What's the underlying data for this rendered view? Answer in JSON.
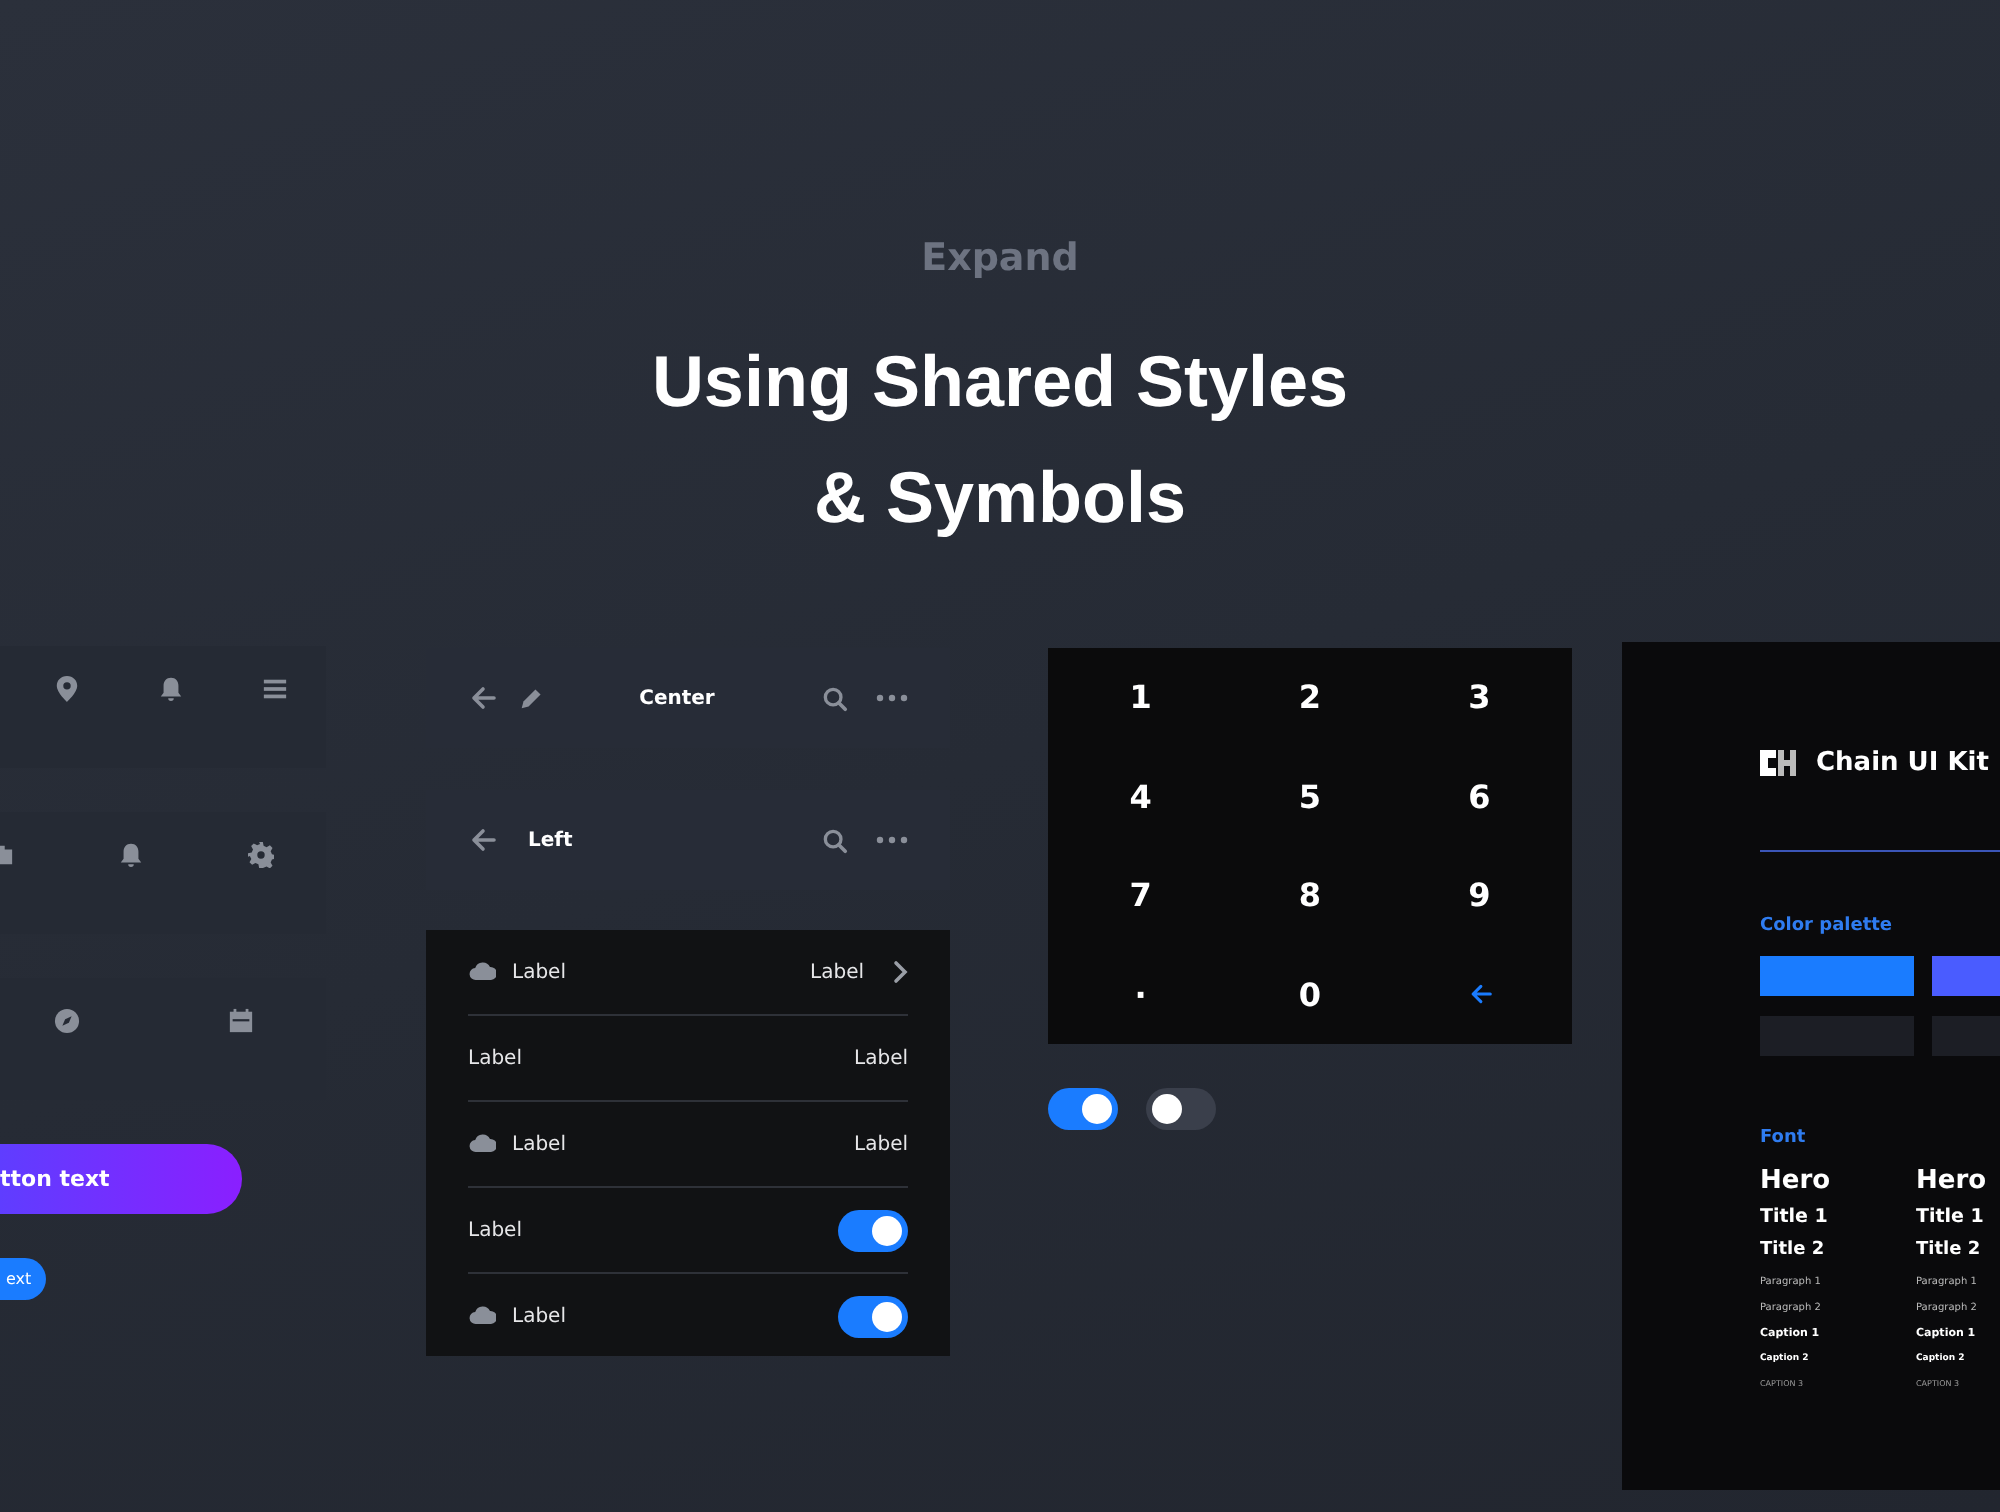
{
  "header": {
    "eyebrow": "Expand",
    "title_lines": [
      "Using Shared Styles",
      "& Symbols"
    ]
  },
  "gradient_button": {
    "label": "tton text"
  },
  "small_button": {
    "label": "ext"
  },
  "nav_bars": [
    {
      "kind": "center",
      "title": "Center"
    },
    {
      "kind": "left",
      "title": "Left"
    }
  ],
  "list_rows": [
    {
      "kind": "detail",
      "label": "Label",
      "cloud": true,
      "value": "Label",
      "chevron": true
    },
    {
      "kind": "detail",
      "label": "Label",
      "cloud": false,
      "value": "Label",
      "chevron": false
    },
    {
      "kind": "detail",
      "label": "Label",
      "cloud": true,
      "value": "Label",
      "chevron": false
    },
    {
      "kind": "toggle",
      "label": "Label",
      "cloud": false,
      "on": true
    },
    {
      "kind": "toggle",
      "label": "Label",
      "cloud": true,
      "on": true
    }
  ],
  "keypad": {
    "keys": [
      {
        "kind": "digit",
        "label": "1"
      },
      {
        "kind": "digit",
        "label": "2"
      },
      {
        "kind": "digit",
        "label": "3"
      },
      {
        "kind": "digit",
        "label": "4"
      },
      {
        "kind": "digit",
        "label": "5"
      },
      {
        "kind": "digit",
        "label": "6"
      },
      {
        "kind": "digit",
        "label": "7"
      },
      {
        "kind": "digit",
        "label": "8"
      },
      {
        "kind": "digit",
        "label": "9"
      },
      {
        "kind": "dot",
        "label": "·"
      },
      {
        "kind": "digit",
        "label": "0"
      },
      {
        "kind": "backspace"
      }
    ]
  },
  "toggles": [
    {
      "on": true
    },
    {
      "on": false
    }
  ],
  "style_guide": {
    "brand": "Chain UI Kit",
    "palette_heading": "Color palette",
    "swatches": [
      {
        "color": "#1a7cff"
      },
      {
        "color": "#4a5cff"
      },
      {
        "color": "#1c1e25"
      },
      {
        "color": "#1c1e25"
      }
    ],
    "font_heading": "Font",
    "type_columns": [
      {
        "styles": [
          {
            "kind": "hero",
            "text": "Hero"
          },
          {
            "kind": "title1",
            "text": "Title 1"
          },
          {
            "kind": "title2",
            "text": "Title 2"
          },
          {
            "kind": "paragraph",
            "text": "Paragraph 1"
          },
          {
            "kind": "paragraph",
            "text": "Paragraph 2"
          },
          {
            "kind": "caption1",
            "text": "Caption 1"
          },
          {
            "kind": "caption2",
            "text": "Caption 2"
          },
          {
            "kind": "caption3",
            "text": "CAPTION 3"
          }
        ]
      },
      {
        "styles": [
          {
            "kind": "hero",
            "text": "Hero"
          },
          {
            "kind": "title1",
            "text": "Title 1"
          },
          {
            "kind": "title2",
            "text": "Title 2"
          },
          {
            "kind": "paragraph",
            "text": "Paragraph 1"
          },
          {
            "kind": "paragraph",
            "text": "Paragraph 2"
          },
          {
            "kind": "caption1",
            "text": "Caption 1"
          },
          {
            "kind": "caption2",
            "text": "Caption 2"
          },
          {
            "kind": "caption3",
            "text": "CAPTION 3"
          }
        ]
      }
    ]
  }
}
